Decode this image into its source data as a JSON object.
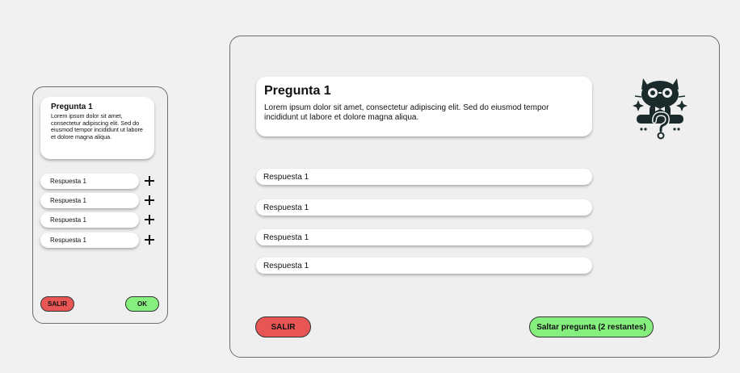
{
  "colors": {
    "exit_button": "#e85555",
    "ok_button": "#86f07f",
    "background": "#efefef",
    "card": "#ffffff"
  },
  "mobile": {
    "question": {
      "title": "Pregunta 1",
      "body": "Lorem ipsum dolor sit amet, consectetur adipiscing elit. Sed do eiusmod tempor incididunt ut labore et dolore magna aliqua."
    },
    "answers": [
      {
        "label": "Respuesta 1",
        "icon": "plus-icon"
      },
      {
        "label": "Respuesta 1",
        "icon": "plus-icon"
      },
      {
        "label": "Respuesta 1",
        "icon": "plus-icon"
      },
      {
        "label": "Respuesta 1",
        "icon": "plus-icon"
      }
    ],
    "exit_label": "SALIR",
    "ok_label": "OK"
  },
  "desktop": {
    "question": {
      "title": "Pregunta 1",
      "body": "Lorem ipsum dolor sit amet, consectetur adipiscing elit. Sed do eiusmod tempor incididunt ut labore et dolore magna aliqua."
    },
    "mascot_icon": "cat-question-mascot-icon",
    "answers": [
      {
        "label": "Respuesta 1"
      },
      {
        "label": "Respuesta 1"
      },
      {
        "label": "Respuesta 1"
      },
      {
        "label": "Respuesta 1"
      }
    ],
    "exit_label": "SALIR",
    "skip_label": "Saltar pregunta (2 restantes)"
  }
}
